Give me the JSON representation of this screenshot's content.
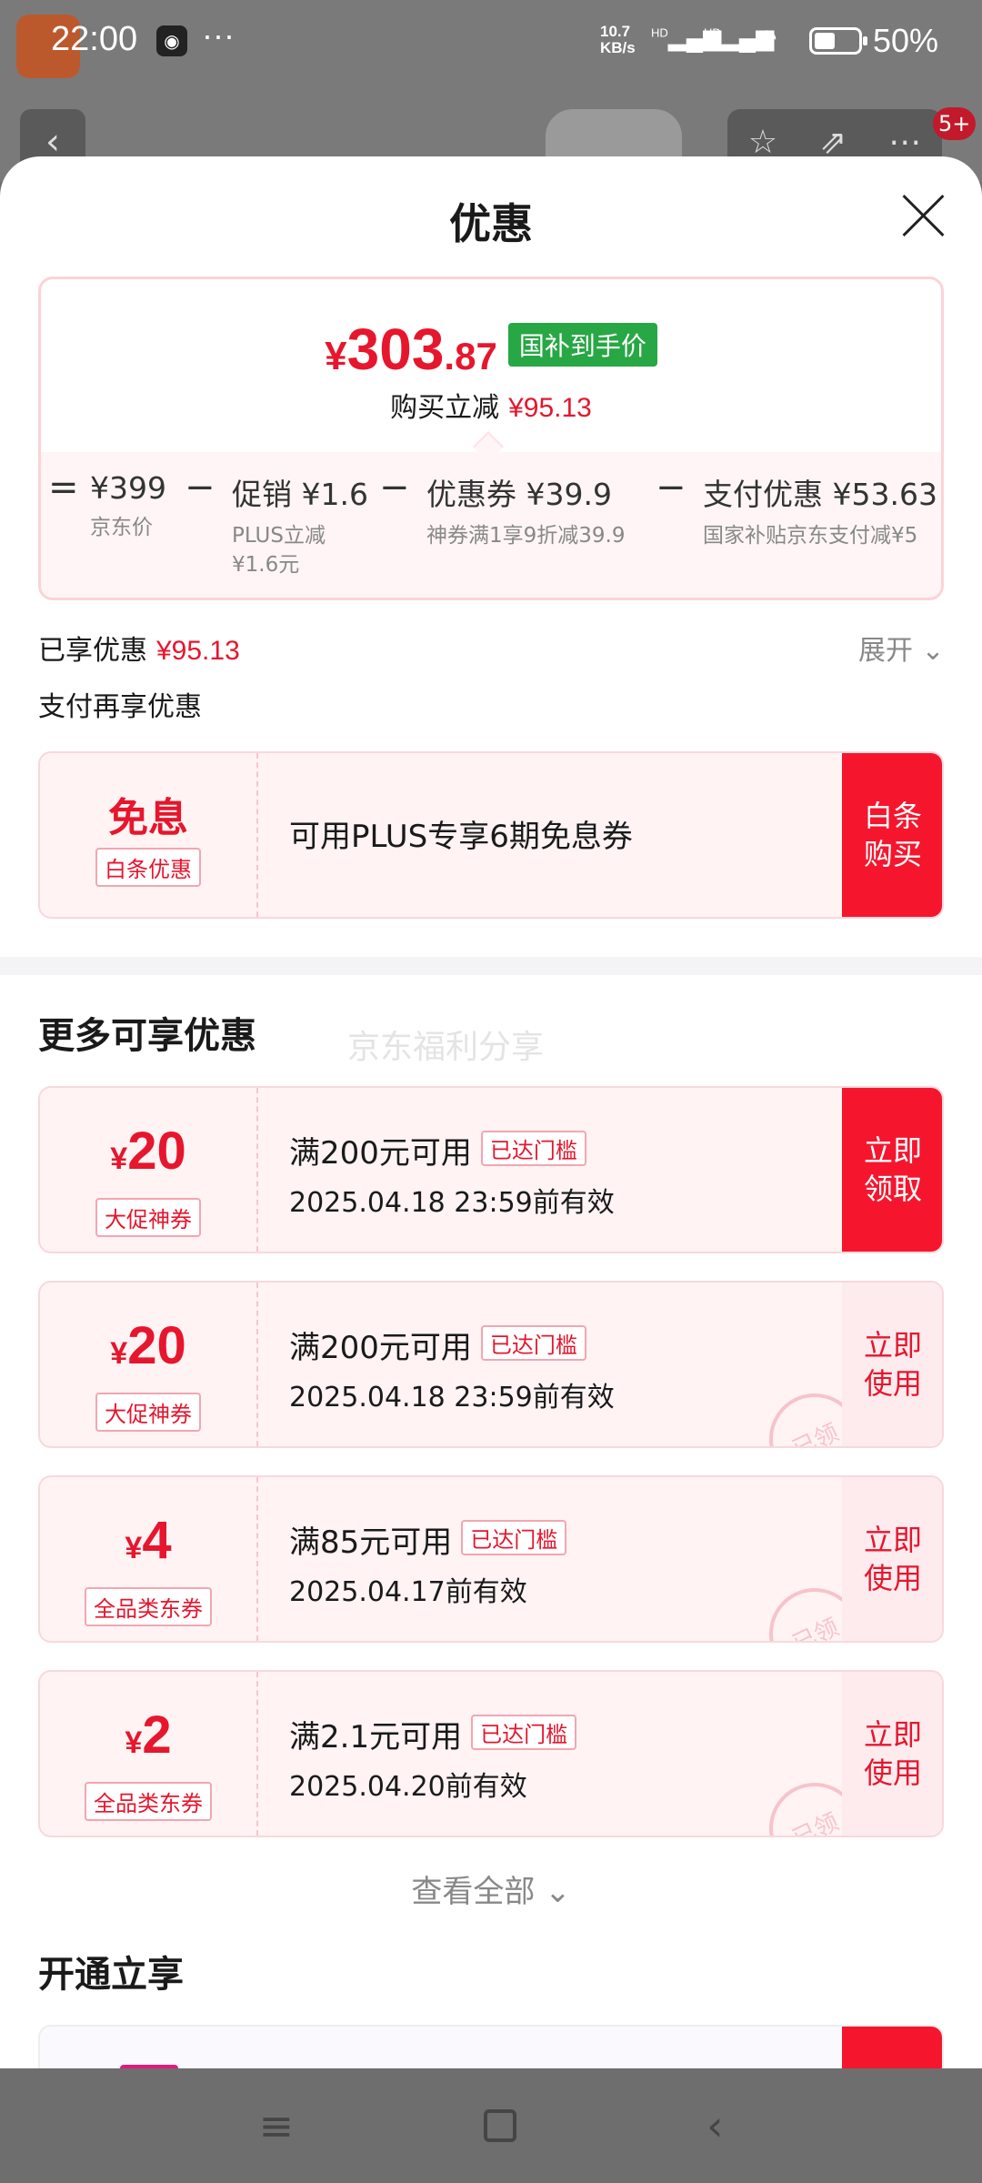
{
  "status": {
    "time": "22:00",
    "net_speed_value": "10.7",
    "net_speed_unit": "KB/s",
    "sig1_label": "HD",
    "sig2_label": "HD",
    "battery": "50%"
  },
  "background": {
    "cart_badge": "5+"
  },
  "sheet": {
    "title": "优惠",
    "price": {
      "currency": "¥",
      "integer": "303",
      "decimal": ".87",
      "tag": "国补到手价",
      "saved_label": "购买立减",
      "saved_value": "¥95.13"
    },
    "breakdown": [
      {
        "op": "=",
        "main": "¥399",
        "sub": "京东价"
      },
      {
        "op": "−",
        "main": "促销 ¥1.6",
        "sub": "PLUS立减\n¥1.6元"
      },
      {
        "op": "−",
        "main": "优惠券 ¥39.9",
        "sub": "神券满1享9折减39.9"
      },
      {
        "op": "−",
        "main": "支付优惠 ¥53.63",
        "sub": "国家补贴京东支付减¥5"
      }
    ],
    "enjoyed_label": "已享优惠",
    "enjoyed_value": "¥95.13",
    "expand_label": "展开",
    "pay_more_label": "支付再享优惠",
    "interest_free": {
      "title": "免息",
      "type": "白条优惠",
      "desc": "可用PLUS专享6期免息券",
      "action": "白条\n购买"
    },
    "more_title": "更多可享优惠",
    "watermark": "京东福利分享",
    "coupons": [
      {
        "currency": "¥",
        "amount": "20",
        "type": "大促神券",
        "condition": "满200元可用",
        "reached": "已达门槛",
        "valid": "2025.04.18 23:59前有效",
        "action": "立即\n领取",
        "claimed": ""
      },
      {
        "currency": "¥",
        "amount": "20",
        "type": "大促神券",
        "condition": "满200元可用",
        "reached": "已达门槛",
        "valid": "2025.04.18 23:59前有效",
        "action": "立即\n使用",
        "claimed": "已领"
      },
      {
        "currency": "¥",
        "amount": "4",
        "type": "全品类东券",
        "condition": "满85元可用",
        "reached": "已达门槛",
        "valid": "2025.04.17前有效",
        "action": "立即\n使用",
        "claimed": "已领"
      },
      {
        "currency": "¥",
        "amount": "2",
        "type": "全品类东券",
        "condition": "满2.1元可用",
        "reached": "已达门槛",
        "valid": "2025.04.20前有效",
        "action": "立即\n使用",
        "claimed": "已领"
      }
    ],
    "view_all_label": "查看全部",
    "open_title": "开通立享"
  },
  "icons": {
    "close": "close-icon",
    "chevron": "chevron-down-icon"
  },
  "colors": {
    "accent_red": "#e6162d",
    "button_red": "#f5162e",
    "tag_green": "#28a745"
  }
}
